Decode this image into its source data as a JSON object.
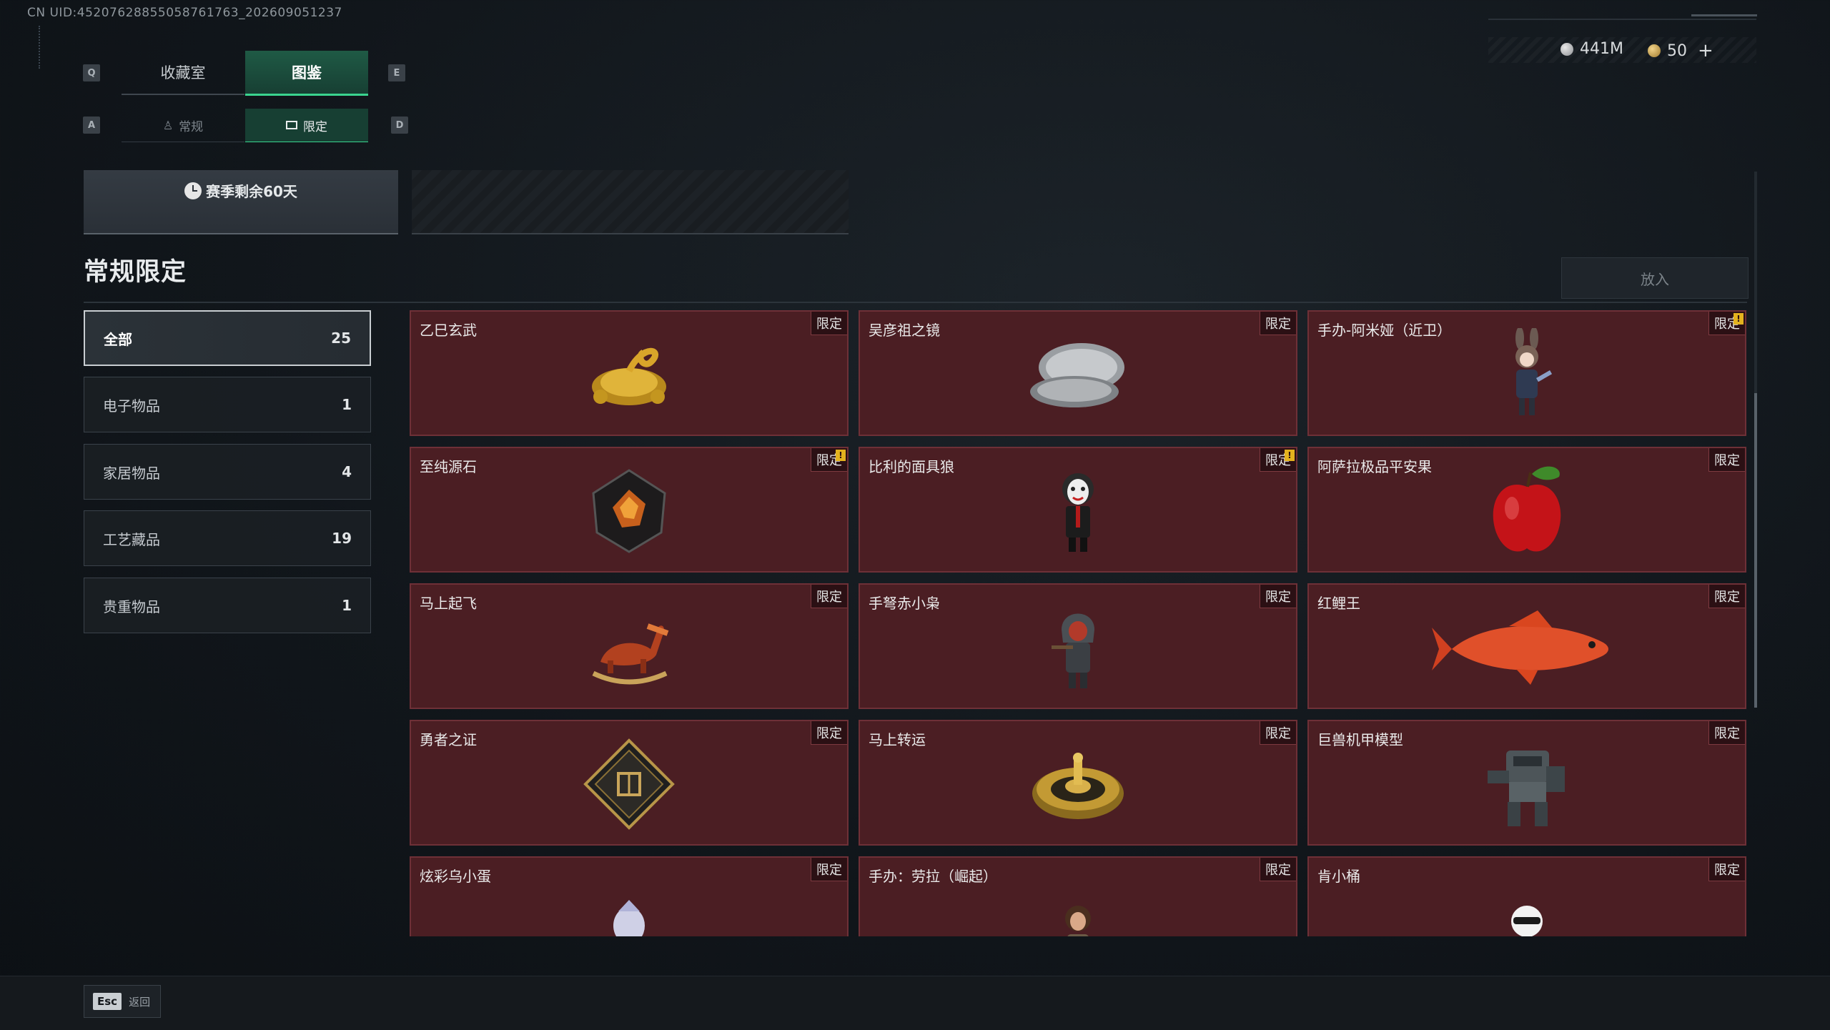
{
  "uid_text": "CN UID:452076288550587617​63_202609051237",
  "tabs": {
    "key_left": "Q",
    "key_right": "E",
    "tab1": "收藏室",
    "tab2": "图鉴"
  },
  "subtabs": {
    "key_left": "A",
    "key_right": "D",
    "sub1": "常规",
    "sub2": "限定"
  },
  "currency": {
    "silver": "441M",
    "gold": "50",
    "add": "+"
  },
  "banner": {
    "season_text": "赛季剩余60天"
  },
  "title": "常规限定",
  "put_in_label": "放入",
  "categories": [
    {
      "label": "全部",
      "count": "25"
    },
    {
      "label": "电子物品",
      "count": "1"
    },
    {
      "label": "家居物品",
      "count": "4"
    },
    {
      "label": "工艺藏品",
      "count": "19"
    },
    {
      "label": "贵重物品",
      "count": "1"
    }
  ],
  "items": [
    {
      "name": "乙巳玄武",
      "tag": "限定",
      "alert": false,
      "icon": "golden-dragon-turtle-icon"
    },
    {
      "name": "吴彦祖之镜",
      "tag": "限定",
      "alert": false,
      "icon": "compact-mirror-icon"
    },
    {
      "name": "手办-阿米娅（近卫）",
      "tag": "限定",
      "alert": true,
      "icon": "amiya-figure-icon"
    },
    {
      "name": "至纯源石",
      "tag": "限定",
      "alert": true,
      "icon": "originium-crystal-icon"
    },
    {
      "name": "比利的面具狼",
      "tag": "限定",
      "alert": true,
      "icon": "billy-puppet-icon"
    },
    {
      "name": "阿萨拉极品平安果",
      "tag": "限定",
      "alert": false,
      "icon": "red-apple-icon"
    },
    {
      "name": "马上起飞",
      "tag": "限定",
      "alert": false,
      "icon": "rocking-horse-icon"
    },
    {
      "name": "手弩赤小枭",
      "tag": "限定",
      "alert": false,
      "icon": "crossbow-figure-icon"
    },
    {
      "name": "红鲤王",
      "tag": "限定",
      "alert": false,
      "icon": "red-carp-icon"
    },
    {
      "name": "勇者之证",
      "tag": "限定",
      "alert": false,
      "icon": "badge-plaque-icon"
    },
    {
      "name": "马上转运",
      "tag": "限定",
      "alert": false,
      "icon": "golden-wheel-icon"
    },
    {
      "name": "巨兽机甲模型",
      "tag": "限定",
      "alert": false,
      "icon": "mech-model-icon"
    },
    {
      "name": "炫彩乌小蛋",
      "tag": "限定",
      "alert": false,
      "icon": "egg-figure-icon"
    },
    {
      "name": "手办：劳拉（崛起）",
      "tag": "限定",
      "alert": false,
      "icon": "lara-figure-icon"
    },
    {
      "name": "肯小桶",
      "tag": "限定",
      "alert": false,
      "icon": "colonel-figure-icon"
    }
  ],
  "footer": {
    "esc_key": "Esc",
    "esc_label": "返回"
  },
  "colors": {
    "accent_green": "#3ad48f",
    "card_bg": "#4b1e23",
    "alert_yellow": "#e3b21e"
  }
}
